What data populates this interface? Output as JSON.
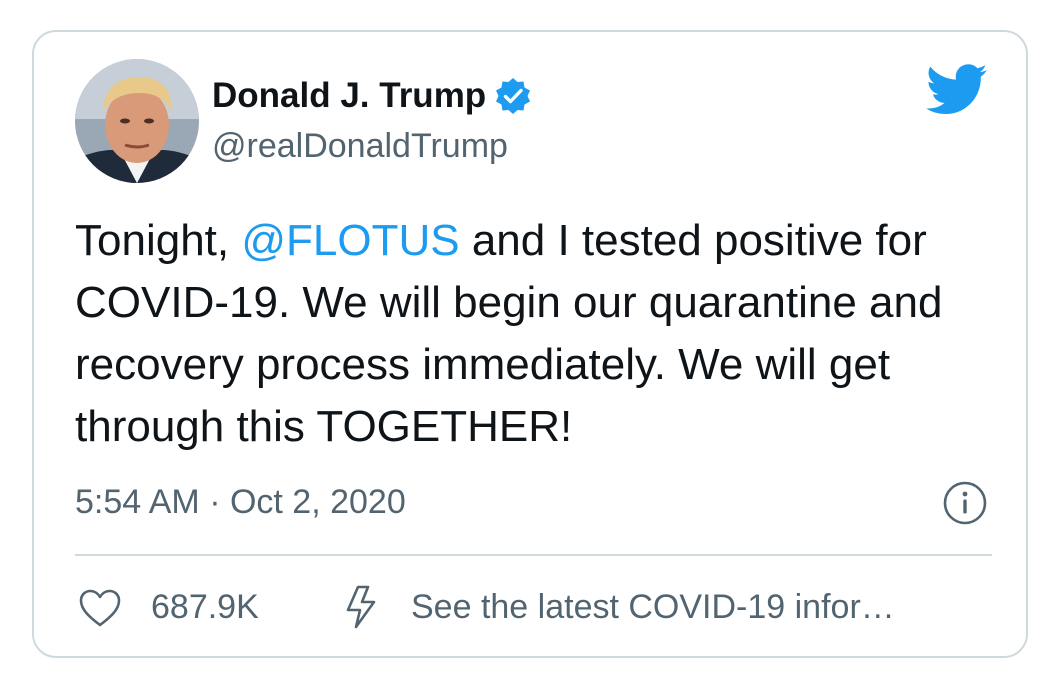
{
  "tweet": {
    "author": {
      "display_name": "Donald J. Trump",
      "handle": "@realDonaldTrump",
      "verified": true
    },
    "text": {
      "part1": "Tonight, ",
      "mention": "@FLOTUS",
      "part2": " and I tested positive for COVID-19. We will begin our quarantine and recovery process immediately. We will get through this TOGETHER!"
    },
    "timestamp": "5:54 AM · Oct 2, 2020",
    "likes": "687.9K",
    "covid_notice": "See the latest COVID-19 infor…"
  },
  "colors": {
    "accent": "#1d9bf0",
    "text_primary": "#0f1419",
    "text_secondary": "#536471",
    "border": "#cfd9de"
  },
  "icons": {
    "brand": "twitter-bird-icon",
    "verified": "verified-badge-icon",
    "info": "info-icon",
    "like": "heart-icon",
    "notice": "lightning-bolt-icon"
  }
}
